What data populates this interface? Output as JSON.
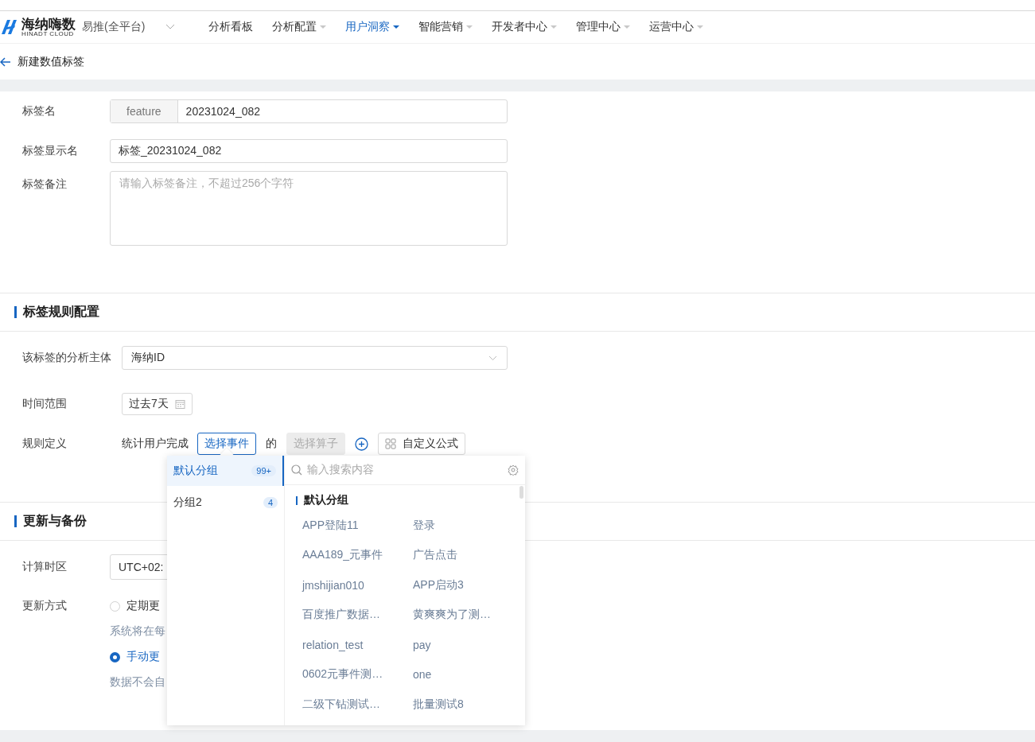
{
  "nav": {
    "logo_name": "海纳嗨数",
    "logo_sub": "HINADT CLOUD",
    "project": "易推(全平台)",
    "menu": [
      {
        "label": "分析看板",
        "selected": false,
        "dropdown": false
      },
      {
        "label": "分析配置",
        "selected": false,
        "dropdown": true
      },
      {
        "label": "用户洞察",
        "selected": true,
        "dropdown": true
      },
      {
        "label": "智能营销",
        "selected": false,
        "dropdown": true
      },
      {
        "label": "开发者中心",
        "selected": false,
        "dropdown": true
      },
      {
        "label": "管理中心",
        "selected": false,
        "dropdown": true
      },
      {
        "label": "运营中心",
        "selected": false,
        "dropdown": true
      }
    ]
  },
  "page_title": "新建数值标签",
  "basic": {
    "tag_name": {
      "label": "标签名",
      "addon": "feature",
      "value": "20231024_082"
    },
    "display_name": {
      "label": "标签显示名",
      "value": "标签_20231024_082"
    },
    "remark": {
      "label": "标签备注",
      "placeholder": "请输入标签备注，不超过256个字符"
    }
  },
  "rules": {
    "title": "标签规则配置",
    "subject": {
      "label": "该标签的分析主体",
      "value": "海纳ID"
    },
    "time_range": {
      "label": "时间范围",
      "value": "过去7天"
    },
    "definition": {
      "label": "规则定义",
      "prefix": "统计用户完成",
      "event_button": "选择事件",
      "of": "的",
      "operator_button": "选择算子",
      "operator_disabled": true,
      "formula_button": "自定义公式"
    }
  },
  "update": {
    "title": "更新与备份",
    "timezone": {
      "label": "计算时区",
      "value": "UTC+02:"
    },
    "mode": {
      "label": "更新方式",
      "options": [
        {
          "label": "定期更",
          "selected": false,
          "hint": "系统将在每"
        },
        {
          "label": "手动更",
          "selected": true,
          "hint": "数据不会自"
        }
      ]
    }
  },
  "event_picker": {
    "groups": [
      {
        "name": "默认分组",
        "count": "99+",
        "selected": true
      },
      {
        "name": "分组2",
        "count": "4",
        "selected": false
      }
    ],
    "search_placeholder": "输入搜索内容",
    "list_heading": "默认分组",
    "events": [
      "APP登陆11",
      "登录",
      "AAA189_元事件",
      "广告点击",
      "jmshijian010",
      "APP启动3",
      "百度推广数据…",
      "黄爽爽为了测…",
      "relation_test",
      "pay",
      "0602元事件测…",
      "one",
      "二级下钻测试…",
      "批量测试8"
    ]
  }
}
